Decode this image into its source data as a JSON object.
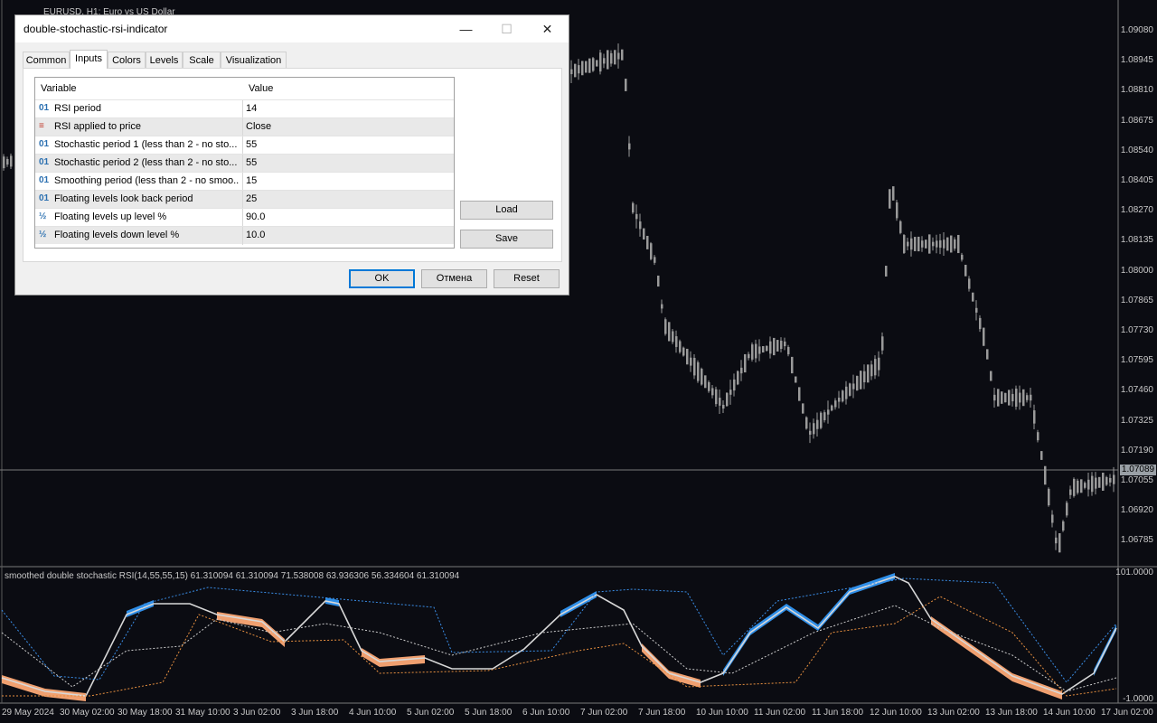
{
  "chart": {
    "title": "EURUSD, H1:  Euro vs US Dollar",
    "price_axis": [
      "1.09080",
      "1.08945",
      "1.08810",
      "1.08675",
      "1.08540",
      "1.08405",
      "1.08270",
      "1.08135",
      "1.08000",
      "1.07865",
      "1.07730",
      "1.07595",
      "1.07460",
      "1.07325",
      "1.07190",
      "1.07055",
      "1.06920",
      "1.06785"
    ],
    "current_price": "1.07089",
    "indicator_axis": [
      "101.0000",
      "-1.0000"
    ],
    "indicator_caption": "smoothed double stochastic RSI(14,55,55,15) 61.310094 61.310094 71.538008 63.936306 56.334604 61.310094",
    "time_axis": [
      "29 May 2024",
      "30 May 02:00",
      "30 May 18:00",
      "31 May 10:00",
      "3 Jun 02:00",
      "3 Jun 18:00",
      "4 Jun 10:00",
      "5 Jun 02:00",
      "5 Jun 18:00",
      "6 Jun 10:00",
      "7 Jun 02:00",
      "7 Jun 18:00",
      "10 Jun 10:00",
      "11 Jun 02:00",
      "11 Jun 18:00",
      "12 Jun 10:00",
      "13 Jun 02:00",
      "13 Jun 18:00",
      "14 Jun 10:00",
      "17 Jun 02:00"
    ],
    "colors": {
      "candle": "#9a9a9a",
      "up_fill": "#2f8fe8",
      "down_fill": "#f0a070",
      "signal": "#d8d8d8",
      "level_up": "#3a8ee8",
      "level_down": "#e89040",
      "mid": "#cccccc"
    }
  },
  "dialog": {
    "title": "double-stochastic-rsi-indicator",
    "window_buttons": [
      "—",
      "☐",
      "✕"
    ],
    "tabs": [
      "Common",
      "Inputs",
      "Colors",
      "Levels",
      "Scale",
      "Visualization"
    ],
    "active_tab": "Inputs",
    "columns": [
      "Variable",
      "Value"
    ],
    "rows": [
      {
        "icon": "01",
        "name": "RSI period",
        "value": "14"
      },
      {
        "icon": "≡",
        "name": "RSI applied to price",
        "value": "Close"
      },
      {
        "icon": "01",
        "name": "Stochastic period 1 (less than 2 - no sto...",
        "value": "55"
      },
      {
        "icon": "01",
        "name": "Stochastic period 2 (less than 2 - no sto...",
        "value": "55"
      },
      {
        "icon": "01",
        "name": "Smoothing period (less than 2 - no smoo...",
        "value": "15"
      },
      {
        "icon": "01",
        "name": "Floating levels look back period",
        "value": "25"
      },
      {
        "icon": "½",
        "name": "Floating levels up level %",
        "value": "90.0"
      },
      {
        "icon": "½",
        "name": "Floating levels down level %",
        "value": "10.0"
      }
    ],
    "load_label": "Load",
    "save_label": "Save",
    "ok_label": "OK",
    "cancel_label": "Отмена",
    "reset_label": "Reset"
  }
}
